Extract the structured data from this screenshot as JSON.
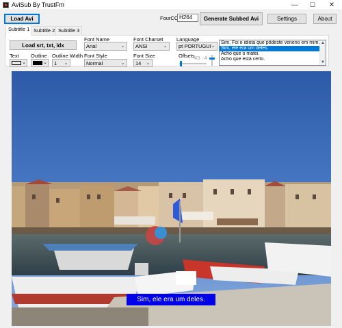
{
  "window": {
    "title": "AviSub By TrustFm",
    "minimize_glyph": "—",
    "maximize_glyph": "☐",
    "close_glyph": "✕"
  },
  "toolbar": {
    "load_avi": "Load Avi",
    "fourcc_label": "FourCC",
    "fourcc_value": "H264",
    "generate": "Generate Subbed Avi",
    "settings": "Settings",
    "about": "About"
  },
  "tabs": [
    "Subtitle 1",
    "Subtitle 2",
    "Subtitle 3"
  ],
  "subtitle_panel": {
    "load_button": "Load srt, txt, idx",
    "font_name_label": "Font Name",
    "font_name_value": "Arial",
    "font_charset_label": "Font Charset",
    "font_charset_value": "ANSI",
    "language_label": "Language",
    "language_value": "pt PORTUGUI",
    "text_label": "Text",
    "outline_label": "Outline",
    "outline_width_label": "Outline Width",
    "outline_width_value": "1",
    "font_style_label": "Font Style",
    "font_style_value": "Normal",
    "font_size_label": "Font Size",
    "font_size_value": "14",
    "offsets_label": "Offsets",
    "offsets_value": "43 : 4",
    "text_color": "#ffffff",
    "outline_color": "#000000"
  },
  "subtitle_list": [
    "Sim. Foi o idiota que pôdeste veneno em mim.",
    "Sim, ele era um deles.",
    "Acho que o matei.",
    "Acho que está certo."
  ],
  "selected_index": 1,
  "video": {
    "caption": "Sim, ele era um deles.",
    "caption_bg": "#0000e6"
  }
}
